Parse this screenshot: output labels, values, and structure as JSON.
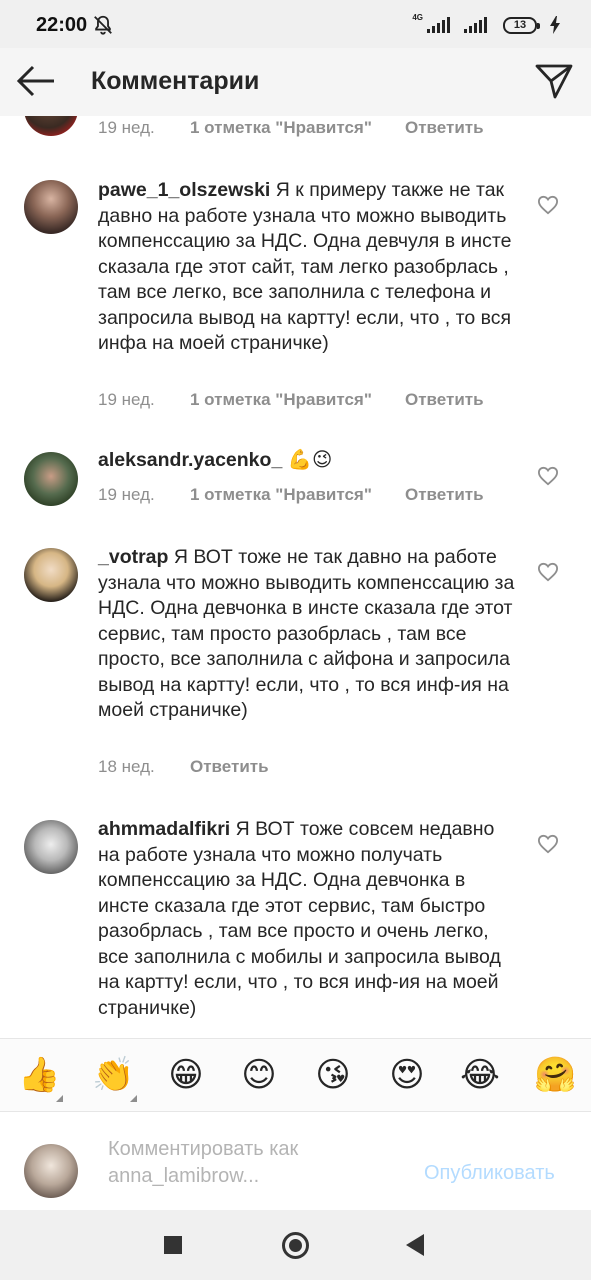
{
  "status_bar": {
    "time": "22:00",
    "network_label": "4G",
    "battery": "13",
    "icons": [
      "mute-icon",
      "signal-icon",
      "battery-icon",
      "charging-icon"
    ]
  },
  "header": {
    "title": "Комментарии",
    "icons": [
      "back-arrow-icon",
      "send-icon"
    ]
  },
  "comments": [
    {
      "username": "",
      "text": "",
      "time": "19 нед.",
      "likes": "1 отметка \"Нравится\"",
      "reply": "Ответить",
      "partial": true
    },
    {
      "username": "pawe_1_olszewski",
      "text": "Я к примеру также  не так давно на работе узнала что можно выводить компенссацию за НДС. Одна девчуля в инсте сказала где этот сайт, там легко разобрлась , там все легко, все заполнила с телефона и запросила вывод на картту! если, что , то вся инфа на моей страничке)",
      "time": "19 нед.",
      "likes": "1 отметка \"Нравится\"",
      "reply": "Ответить"
    },
    {
      "username": "aleksandr.yacenko_",
      "text": "💪😉",
      "time": "19 нед.",
      "likes": "1 отметка \"Нравится\"",
      "reply": "Ответить"
    },
    {
      "username": "_votrap",
      "text": "Я ВОТ тоже  не так давно на работе узнала что можно выводить компенссацию за НДС. Одна девчонка в инсте сказала где этот сервис, там просто разобрлась , там все просто, все заполнила с айфона и запросила вывод на картту! если, что , то вся инф-ия на моей страничке)",
      "time": "18 нед.",
      "likes": "",
      "reply": "Ответить"
    },
    {
      "username": "ahmmadalfikri",
      "text": "Я ВОТ тоже совсем недавно на работе узнала что можно получать компенссацию за НДС. Одна девчонка в инсте сказала где этот сервис, там быстро разобрлась , там все просто и очень легко, все заполнила с мобилы и запросила вывод на картту! если, что , то вся инф-ия на моей страничке)",
      "time": "",
      "likes": "",
      "reply": ""
    }
  ],
  "emoji_bar": [
    "👍",
    "👏",
    "😁",
    "😊",
    "😘",
    "😍",
    "😂",
    "🤗"
  ],
  "compose": {
    "placeholder_line1": "Комментировать как",
    "placeholder_line2": "anna_lamibrow...",
    "publish_label": "Опубликовать"
  },
  "nav_bar": {
    "icons": [
      "recent-apps-icon",
      "home-icon",
      "back-icon"
    ]
  },
  "colors": {
    "link_disabled": "#b3dbff",
    "meta_gray": "#8e8e8e",
    "text": "#262626"
  }
}
